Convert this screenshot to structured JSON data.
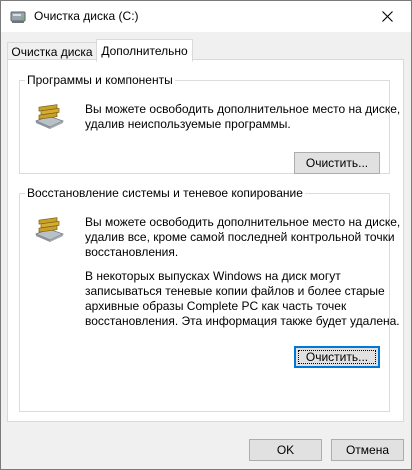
{
  "window": {
    "title": "Очистка диска  (C:)"
  },
  "tabs": [
    {
      "label": "Очистка диска",
      "active": false
    },
    {
      "label": "Дополнительно",
      "active": true
    }
  ],
  "programs_group": {
    "title": "Программы и компоненты",
    "description_lines": [
      "Вы можете освободить дополнительное место на диске,",
      "удалив неиспользуемые программы."
    ],
    "button_label": "Очистить...",
    "icon": "package-icon"
  },
  "restore_group": {
    "title": "Восстановление системы и теневое копирование",
    "description_lines": [
      "Вы можете освободить дополнительное место на диске,",
      "удалив все, кроме самой последней контрольной точки",
      "восстановления."
    ],
    "note_lines": [
      "В некоторых выпусках Windows на диск могут",
      "записываться теневые копии файлов и более старые",
      "архивные образы Complete PC как часть точек",
      "восстановления. Эта информация также будет удалена."
    ],
    "button_label": "Очистить...",
    "icon": "package-icon"
  },
  "footer": {
    "ok_label": "OK",
    "cancel_label": "Отмена"
  },
  "colors": {
    "focus_blue": "#0078d7",
    "button_face": "#e1e1e1",
    "dialog_bg": "#f0f0f0"
  }
}
